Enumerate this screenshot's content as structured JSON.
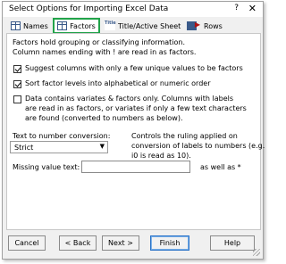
{
  "window": {
    "title": "Select Options for Importing Excel Data",
    "help_glyph": "?",
    "close_glyph": "✕"
  },
  "tabs": [
    {
      "label": "Names",
      "icon": "grid-icon"
    },
    {
      "label": "Factors",
      "icon": "grid-icon",
      "active": true
    },
    {
      "label": "Title/Active Sheet",
      "icon": "title-sheet-icon"
    },
    {
      "label": "Rows",
      "icon": "rows-icon"
    }
  ],
  "factors_panel": {
    "intro_line1": "Factors hold grouping or classifying information.",
    "intro_line2": "Column names ending with ! are read in as factors.",
    "options": [
      {
        "label": "Suggest columns with only a few unique values to be factors",
        "checked": true
      },
      {
        "label": "Sort factor levels into alphabetical or numeric order",
        "checked": true
      },
      {
        "label_lines": [
          "Data contains variates & factors only. Columns with labels",
          "are read in as factors, or variates if only a few text characters",
          "are found (converted to numbers as below)."
        ],
        "checked": false
      }
    ],
    "conversion_label": "Text to number conversion:",
    "conversion_value": "Strict",
    "conversion_help_lines": [
      "Controls the ruling applied on",
      "conversion of labels to numbers (e.g.",
      "i0 is read as 10)."
    ],
    "missing_label": "Missing value text:",
    "missing_value": "",
    "missing_suffix": "as well as *"
  },
  "buttons": {
    "cancel": "Cancel",
    "back": "< Back",
    "next": "Next >",
    "finish": "Finish",
    "help": "Help"
  },
  "colors": {
    "active_tab_border": "#21a34a",
    "default_button_border": "#2a73c8"
  }
}
